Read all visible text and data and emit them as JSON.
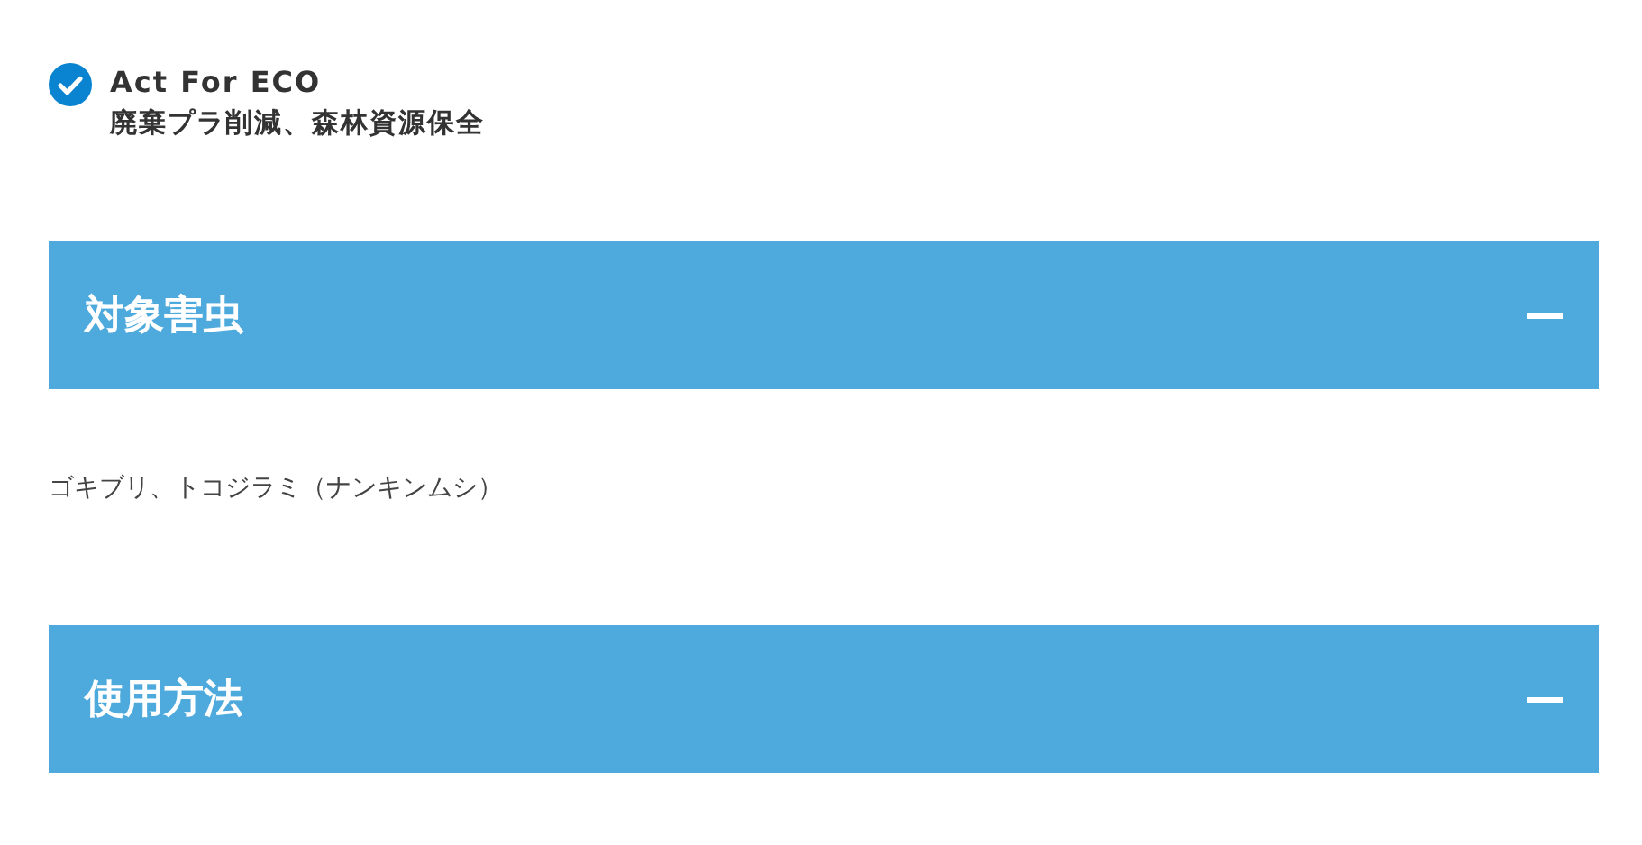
{
  "eco_badge": {
    "checked": true,
    "title": "Act For ECO",
    "subtitle": "廃棄プラ削減、森林資源保全"
  },
  "sections": [
    {
      "title": "対象害虫",
      "expanded": true,
      "body": "ゴキブリ、トコジラミ（ナンキンムシ）"
    },
    {
      "title": "使用方法",
      "expanded": true
    }
  ]
}
